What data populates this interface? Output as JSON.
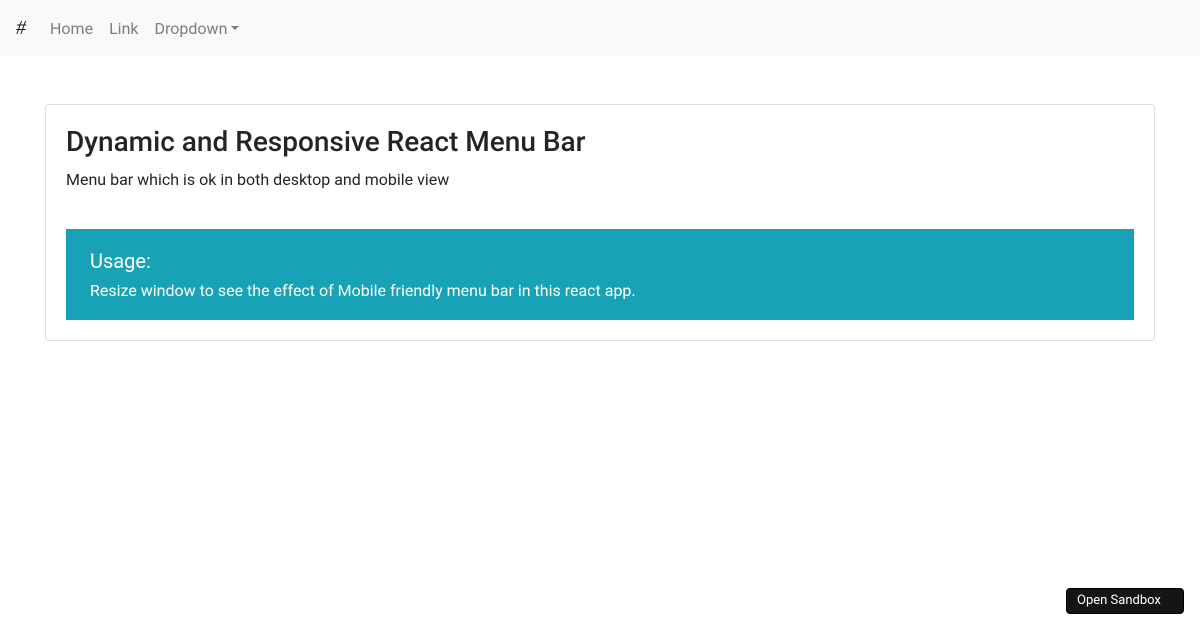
{
  "navbar": {
    "brand_label": "#",
    "items": [
      {
        "label": "Home"
      },
      {
        "label": "Link"
      },
      {
        "label": "Dropdown"
      }
    ]
  },
  "card": {
    "title": "Dynamic and Responsive React Menu Bar",
    "subtitle": "Menu bar which is ok in both desktop and mobile view"
  },
  "usage": {
    "heading": "Usage:",
    "text": "Resize window to see the effect of Mobile friendly menu bar in this react app."
  },
  "sandbox_button": "Open Sandbox"
}
